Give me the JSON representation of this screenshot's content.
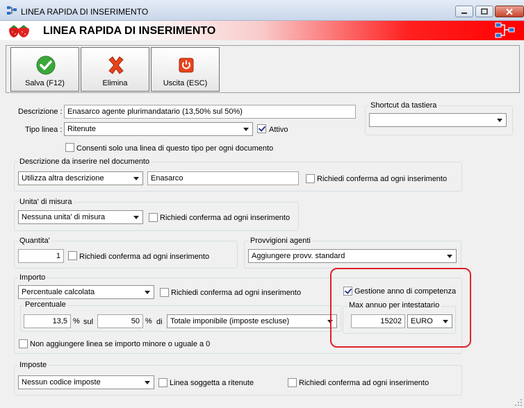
{
  "window": {
    "title": "LINEA RAPIDA DI INSERIMENTO",
    "header_title": "LINEA RAPIDA DI INSERIMENTO"
  },
  "toolbar": {
    "save_label": "Salva (F12)",
    "delete_label": "Elimina",
    "exit_label": "Uscita (ESC)"
  },
  "form": {
    "descrizione_label": "Descrizione :",
    "descrizione_value": "Enasarco agente plurimandatario (13,50% sul 50%)",
    "tipo_linea_label": "Tipo linea :",
    "tipo_linea_value": "Ritenute",
    "attivo_label": "Attivo",
    "attivo_checked": true,
    "consenti_label": "Consenti solo una linea di questo tipo per ogni documento",
    "consenti_checked": false
  },
  "shortcut": {
    "group_label": "Shortcut da tastiera",
    "value": ""
  },
  "descrizione_doc": {
    "group_label": "Descrizione da inserire nel documento",
    "mode_value": "Utilizza altra descrizione",
    "text_value": "Enasarco",
    "confirm_label": "Richiedi conferma ad ogni inserimento"
  },
  "unita": {
    "group_label": "Unita' di misura",
    "value": "Nessuna unita' di misura",
    "confirm_label": "Richiedi conferma ad ogni inserimento"
  },
  "quantita": {
    "group_label": "Quantita'",
    "value": "1",
    "confirm_label": "Richiedi conferma ad ogni inserimento"
  },
  "provvigioni": {
    "group_label": "Provvigioni agenti",
    "value": "Aggiungere provv. standard"
  },
  "importo": {
    "group_label": "Importo",
    "mode_value": "Percentuale calcolata",
    "confirm_label": "Richiedi conferma ad ogni inserimento",
    "percentuale_group_label": "Percentuale",
    "perc_value": "13,5",
    "perc_unit": "%",
    "sul_label": "sul",
    "sul_value": "50",
    "sul_unit": "%",
    "di_label": "di",
    "base_value": "Totale imponibile (imposte escluse)",
    "non_aggiungere_label": "Non aggiungere linea se importo minore o uguale a 0",
    "gestione_anno_label": "Gestione anno di competenza",
    "gestione_anno_checked": true,
    "max_group_label": "Max annuo per intestatario",
    "max_value": "15202",
    "currency_value": "EURO"
  },
  "imposte": {
    "group_label": "Imposte",
    "value": "Nessun codice imposte",
    "ritenute_label": "Linea soggetta a ritenute",
    "confirm_label": "Richiedi conferma ad ogni inserimento"
  },
  "colors": {
    "highlight_border": "#e0202a",
    "header_red": "#ff0000"
  }
}
